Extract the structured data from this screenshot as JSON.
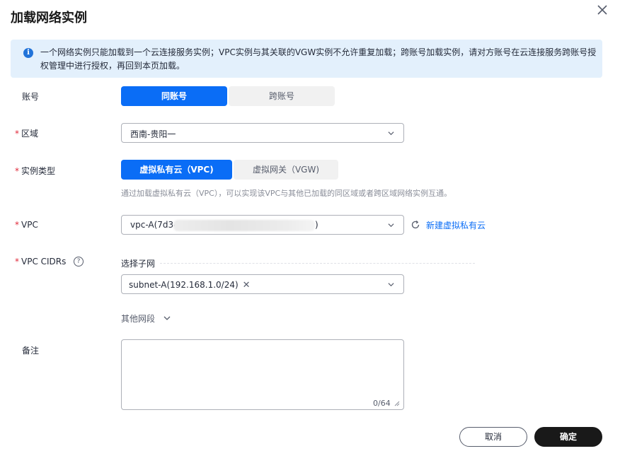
{
  "dialog": {
    "title": "加载网络实例"
  },
  "notice": {
    "icon": "info-icon",
    "text": "一个网络实例只能加载到一个云连接服务实例；VPC实例与其关联的VGW实例不允许重复加载；跨账号加载实例，请对方账号在云连接服务跨账号授权管理中进行授权，再回到本页加载。"
  },
  "account": {
    "label": "账号",
    "options": [
      "同账号",
      "跨账号"
    ],
    "selected": "同账号"
  },
  "region": {
    "label": "区域",
    "value": "西南-贵阳一"
  },
  "instance_type": {
    "label": "实例类型",
    "options": [
      "虚拟私有云（VPC)",
      "虚拟网关（VGW)"
    ],
    "selected": "虚拟私有云（VPC)",
    "hint": "通过加载虚拟私有云（VPC），可以实现该VPC与其他已加载的同区域或者跨区域网络实例互通。"
  },
  "vpc": {
    "label": "VPC",
    "value_prefix": "vpc-A(7d34",
    "value_suffix": ")",
    "create_link": "新建虚拟私有云"
  },
  "vpc_cidrs": {
    "label": "VPC CIDRs",
    "subnet_title": "选择子网",
    "selected_tag": "subnet-A(192.168.1.0/24)",
    "more_label": "其他网段"
  },
  "remark": {
    "label": "备注",
    "value": "",
    "counter": "0/64"
  },
  "footer": {
    "cancel_label": "取消",
    "ok_label": "确定"
  },
  "colors": {
    "accent": "#0a6df6",
    "required": "#e0293a",
    "notice_bg": "#e3f0fc",
    "primary_button": "#191919"
  }
}
